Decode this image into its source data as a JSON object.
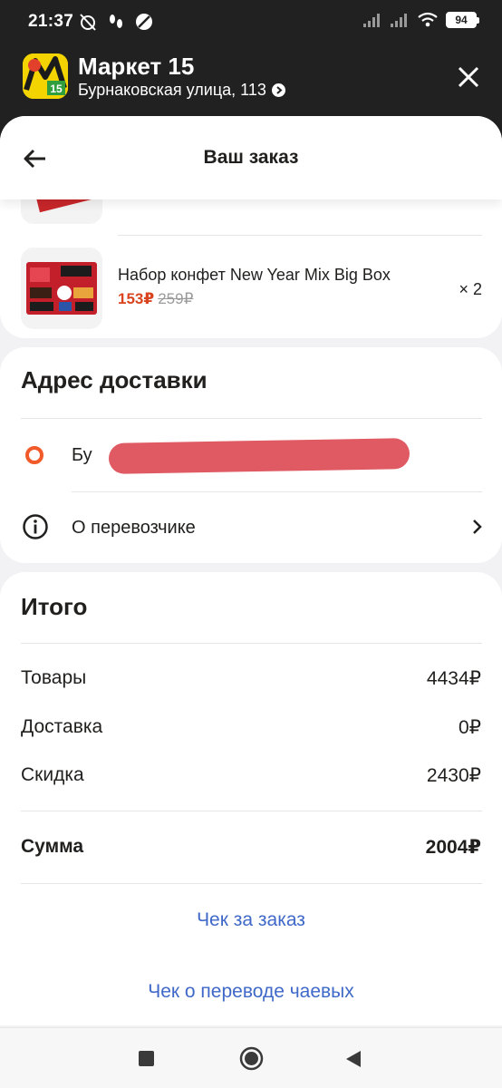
{
  "status_bar": {
    "time": "21:37",
    "battery": "94"
  },
  "store": {
    "name": "Маркет 15",
    "address": "Бурнаковская улица, 113",
    "logo_badge": "15"
  },
  "header": {
    "title": "Ваш заказ",
    "back_icon": "arrow-left-icon",
    "close_icon": "close-icon"
  },
  "order_items": [
    {
      "title": "Набор конфет New Year Mix Big Box",
      "price_new": "153₽",
      "price_old": "259₽",
      "quantity": "× 2"
    }
  ],
  "delivery": {
    "title": "Адрес доставки",
    "address_visible_start": "Бу",
    "carrier_label": "О перевозчике"
  },
  "totals": {
    "title": "Итого",
    "rows": [
      {
        "label": "Товары",
        "value": "4434₽"
      },
      {
        "label": "Доставка",
        "value": "0₽"
      },
      {
        "label": "Скидка",
        "value": "2430₽"
      }
    ],
    "sum_label": "Сумма",
    "sum_value": "2004₽"
  },
  "links": {
    "receipt": "Чек за заказ",
    "tips_receipt": "Чек о переводе чаевых"
  },
  "colors": {
    "dark_header": "#212121",
    "price_accent": "#d9441f",
    "link": "#3f68c8",
    "address_marker": "#f25a2a",
    "logo_yellow": "#f4d400"
  }
}
